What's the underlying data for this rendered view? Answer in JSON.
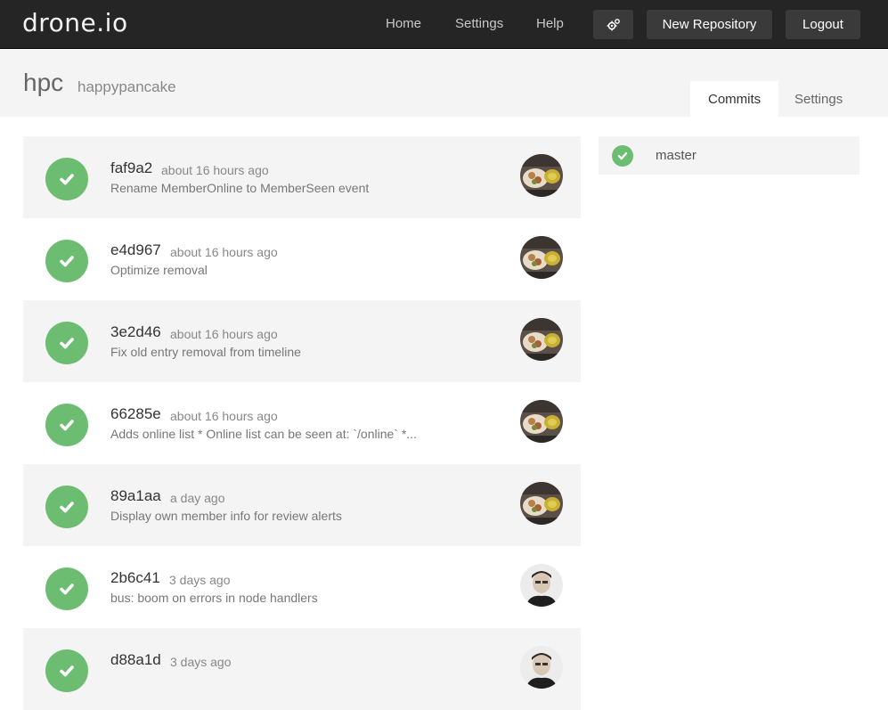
{
  "app": {
    "logo": "drone.io"
  },
  "nav": {
    "home": "Home",
    "settings": "Settings",
    "help": "Help",
    "new_repository": "New Repository",
    "logout": "Logout",
    "tools_icon": "gears-icon"
  },
  "repo": {
    "owner": "hpc",
    "name": "happypancake"
  },
  "tabs": [
    {
      "label": "Commits",
      "active": true
    },
    {
      "label": "Settings",
      "active": false
    }
  ],
  "commits": [
    {
      "sha": "faf9a2",
      "when": "about 16 hours ago",
      "message": "Rename MemberOnline to MemberSeen event",
      "status": "success",
      "avatar": "food-photo"
    },
    {
      "sha": "e4d967",
      "when": "about 16 hours ago",
      "message": "Optimize removal",
      "status": "success",
      "avatar": "food-photo"
    },
    {
      "sha": "3e2d46",
      "when": "about 16 hours ago",
      "message": "Fix old entry removal from timeline",
      "status": "success",
      "avatar": "food-photo"
    },
    {
      "sha": "66285e",
      "when": "about 16 hours ago",
      "message": "Adds online list * Online list can be seen at: `/online` *...",
      "status": "success",
      "avatar": "food-photo"
    },
    {
      "sha": "89a1aa",
      "when": "a day ago",
      "message": "Display own member info for review alerts",
      "status": "success",
      "avatar": "food-photo"
    },
    {
      "sha": "2b6c41",
      "when": "3 days ago",
      "message": "bus: boom on errors in node handlers",
      "status": "success",
      "avatar": "person-photo"
    },
    {
      "sha": "d88a1d",
      "when": "3 days ago",
      "message": "",
      "status": "success",
      "avatar": "person-photo"
    }
  ],
  "branches": [
    {
      "name": "master",
      "status": "success"
    }
  ],
  "colors": {
    "topbar": "#252525",
    "success": "#6cbd72",
    "shade": "#f4f4f4"
  }
}
